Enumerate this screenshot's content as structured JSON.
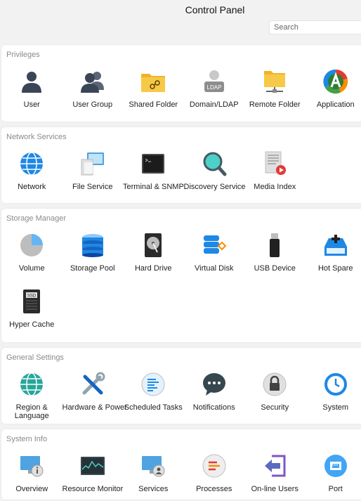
{
  "header": {
    "title": "Control Panel",
    "search_placeholder": "Search"
  },
  "sections": {
    "privileges": {
      "title": "Privileges",
      "items": [
        {
          "label": "User",
          "icon": "user-icon"
        },
        {
          "label": "User Group",
          "icon": "user-group-icon"
        },
        {
          "label": "Shared Folder",
          "icon": "shared-folder-icon"
        },
        {
          "label": "Domain/LDAP",
          "icon": "ldap-icon",
          "icon_text": "LDAP"
        },
        {
          "label": "Remote Folder",
          "icon": "remote-folder-icon"
        },
        {
          "label": "Application",
          "icon": "application-icon"
        }
      ]
    },
    "network": {
      "title": "Network Services",
      "items": [
        {
          "label": "Network",
          "icon": "globe-icon"
        },
        {
          "label": "File Service",
          "icon": "file-service-icon"
        },
        {
          "label": "Terminal & SNMP",
          "icon": "terminal-icon"
        },
        {
          "label": "Discovery Service",
          "icon": "magnifier-icon"
        },
        {
          "label": "Media Index",
          "icon": "media-index-icon"
        }
      ]
    },
    "storage": {
      "title": "Storage Manager",
      "items": [
        {
          "label": "Volume",
          "icon": "volume-pie-icon"
        },
        {
          "label": "Storage Pool",
          "icon": "storage-pool-icon"
        },
        {
          "label": "Hard Drive",
          "icon": "hard-drive-icon"
        },
        {
          "label": "Virtual Disk",
          "icon": "virtual-disk-icon"
        },
        {
          "label": "USB Device",
          "icon": "usb-icon"
        },
        {
          "label": "Hot Spare",
          "icon": "hot-spare-icon"
        },
        {
          "label": "Hyper Cache",
          "icon": "ssd-icon",
          "icon_text": "SSD"
        }
      ]
    },
    "general": {
      "title": "General Settings",
      "items": [
        {
          "label": "Region & Language",
          "icon": "region-globe-icon"
        },
        {
          "label": "Hardware & Power",
          "icon": "tools-icon"
        },
        {
          "label": "Scheduled Tasks",
          "icon": "tasks-icon"
        },
        {
          "label": "Notifications",
          "icon": "chat-bubble-icon"
        },
        {
          "label": "Security",
          "icon": "lock-icon"
        },
        {
          "label": "System",
          "icon": "system-clock-icon"
        }
      ]
    },
    "system": {
      "title": "System Info",
      "items": [
        {
          "label": "Overview",
          "icon": "overview-icon"
        },
        {
          "label": "Resource Monitor",
          "icon": "resource-monitor-icon"
        },
        {
          "label": "Services",
          "icon": "services-icon"
        },
        {
          "label": "Processes",
          "icon": "processes-icon"
        },
        {
          "label": "On-line Users",
          "icon": "online-users-icon"
        },
        {
          "label": "Port",
          "icon": "port-icon"
        }
      ]
    }
  }
}
